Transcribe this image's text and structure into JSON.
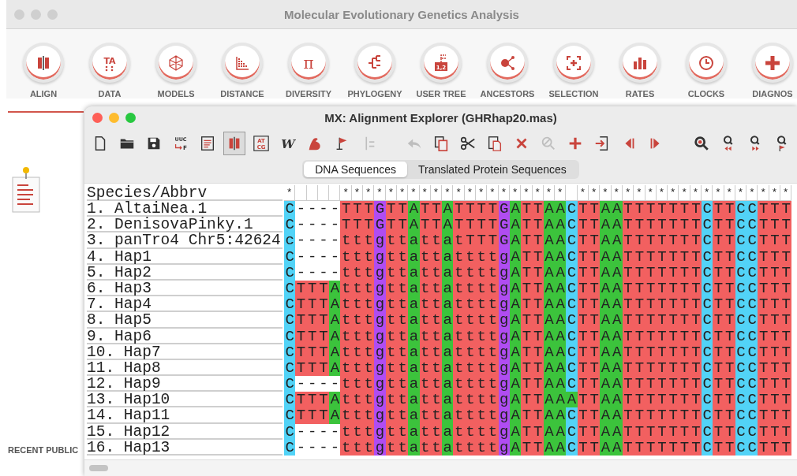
{
  "mega": {
    "title": "Molecular Evolutionary Genetics Analysis",
    "modules": [
      {
        "kind": "align",
        "label": "ALIGN"
      },
      {
        "kind": "data",
        "label": "DATA",
        "glyph": "TA"
      },
      {
        "kind": "models",
        "label": "MODELS"
      },
      {
        "kind": "distance",
        "label": "DISTANCE"
      },
      {
        "kind": "diversity",
        "label": "DIVERSITY",
        "glyph": "π"
      },
      {
        "kind": "phylogeny",
        "label": "PHYLOGENY"
      },
      {
        "kind": "user_tree",
        "label": "USER TREE",
        "glyph": "1,2"
      },
      {
        "kind": "ancestors",
        "label": "ANCESTORS"
      },
      {
        "kind": "selection",
        "label": "SELECTION"
      },
      {
        "kind": "rates",
        "label": "RATES"
      },
      {
        "kind": "clocks",
        "label": "CLOCKS"
      },
      {
        "kind": "diagnose",
        "label": "DIAGNOS"
      }
    ],
    "recent_heading": "RECENT PUBLIC"
  },
  "explorer": {
    "title": "MX: Alignment Explorer (GHRhap20.mas)",
    "toolbar": [
      {
        "items": [
          {
            "kind": "new",
            "disabled": false,
            "selected": false
          },
          {
            "kind": "open",
            "disabled": false,
            "selected": false
          },
          {
            "kind": "save",
            "disabled": false,
            "selected": false
          },
          {
            "kind": "translate",
            "text": "UUC",
            "subtext": "F",
            "disabled": false,
            "selected": false
          },
          {
            "kind": "doc",
            "disabled": false,
            "selected": false
          },
          {
            "kind": "align",
            "disabled": false,
            "selected": true
          },
          {
            "kind": "atcg",
            "text": "AT",
            "subtext": "CG",
            "disabled": false,
            "selected": false
          },
          {
            "kind": "web",
            "text": "W",
            "disabled": false,
            "selected": false
          },
          {
            "kind": "muscle",
            "disabled": false,
            "selected": false
          },
          {
            "kind": "flag",
            "disabled": false,
            "selected": false
          },
          {
            "kind": "move",
            "disabled": true,
            "selected": false
          }
        ]
      },
      {
        "items": [
          {
            "kind": "undo",
            "disabled": true,
            "selected": false
          },
          {
            "kind": "copy",
            "disabled": false,
            "selected": false
          },
          {
            "kind": "cut",
            "disabled": false,
            "selected": false
          },
          {
            "kind": "paste",
            "disabled": false,
            "selected": false
          },
          {
            "kind": "delete",
            "disabled": false,
            "selected": false
          },
          {
            "kind": "clear",
            "disabled": true,
            "selected": false
          },
          {
            "kind": "add",
            "disabled": false,
            "selected": false
          },
          {
            "kind": "import",
            "disabled": false,
            "selected": false
          },
          {
            "kind": "prev",
            "disabled": false,
            "selected": false
          },
          {
            "kind": "next",
            "disabled": false,
            "selected": false
          }
        ]
      },
      {
        "items": [
          {
            "kind": "search",
            "disabled": false,
            "selected": false
          },
          {
            "kind": "search_prev",
            "disabled": false,
            "selected": false
          },
          {
            "kind": "search_next",
            "disabled": false,
            "selected": false
          },
          {
            "kind": "search_flag",
            "disabled": false,
            "selected": false
          }
        ]
      }
    ],
    "tabs": [
      {
        "label": "DNA Sequences",
        "selected": true
      },
      {
        "label": "Translated Protein Sequences",
        "selected": false
      }
    ],
    "header": "Species/Abbrv",
    "consensus_mark": "*",
    "conserved": [
      true,
      false,
      false,
      false,
      false,
      true,
      true,
      true,
      true,
      true,
      true,
      true,
      true,
      true,
      true,
      true,
      true,
      true,
      true,
      true,
      true,
      true,
      true,
      true,
      true,
      false,
      true,
      true,
      true,
      true,
      true,
      true,
      true,
      true,
      true,
      true,
      true,
      true,
      true,
      true,
      true,
      true,
      true,
      true,
      true
    ],
    "rows": [
      {
        "name": "1. AltaiNea.1",
        "sequence": "C----TTTGTTATTATTTTGATTAACTTAATTTTTTTCTTCCTTT"
      },
      {
        "name": "2. DenisovaPinky.1",
        "sequence": "C----TTTGTTATTATTTTGATTAACTTAATTTTTTTCTTCCTTT"
      },
      {
        "name": "3. panTro4 Chr5:42624",
        "sequence": "c----tttgttattatTTTGATTAACTTAATTTTTTTCTTCCTTT"
      },
      {
        "name": "4. Hap1",
        "sequence": "C----tttgttattattttgATTAACTTAATTTTTTTCTTCCTTT"
      },
      {
        "name": "5. Hap2",
        "sequence": "C----tttgttattattttgATTAACTTAATTTTTTTCTTCCTTT"
      },
      {
        "name": "6. Hap3",
        "sequence": "CTTTAtttgttattattttgATTAACTTAATTTTTTTCTTCCTTT"
      },
      {
        "name": "7. Hap4",
        "sequence": "CTTTAtttgttattattttgATTAACTTAATTTTTTTCTTCCTTT"
      },
      {
        "name": "8. Hap5",
        "sequence": "CTTTAtttgttattattttgATTAACTTAATTTTTTTCTTCCTTT"
      },
      {
        "name": "9. Hap6",
        "sequence": "CTTTAtttgttattattttgATTAACTTAATTTTTTTCTTCCTTT"
      },
      {
        "name": "10. Hap7",
        "sequence": "CTTTAtttgttattattttgATTAACTTAATTTTTTTCTTCCTTT"
      },
      {
        "name": "11. Hap8",
        "sequence": "CTTTAtttgttattattttgATTAACTTAATTTTTTTCTTCCTTT"
      },
      {
        "name": "12. Hap9",
        "sequence": "C----tttgttattattttgATTAACTTAATTTTTTTCTTCCTTT"
      },
      {
        "name": "13. Hap10",
        "sequence": "CTTTAtttgttattattttgATTAAATTAATTTTTTTCTTCCTTT"
      },
      {
        "name": "14. Hap11",
        "sequence": "CTTTAtttgttattattttgATTAACTTAATTTTTTTCTTCCTTT"
      },
      {
        "name": "15. Hap12",
        "sequence": "C----tttgttattattttgATTAACTTAATTTTTTTCTTCCTTT"
      },
      {
        "name": "16. Hap13",
        "sequence": "C----tttgttattattttgATTAACTTAATTTTTTTCTTCCTTT"
      }
    ]
  }
}
